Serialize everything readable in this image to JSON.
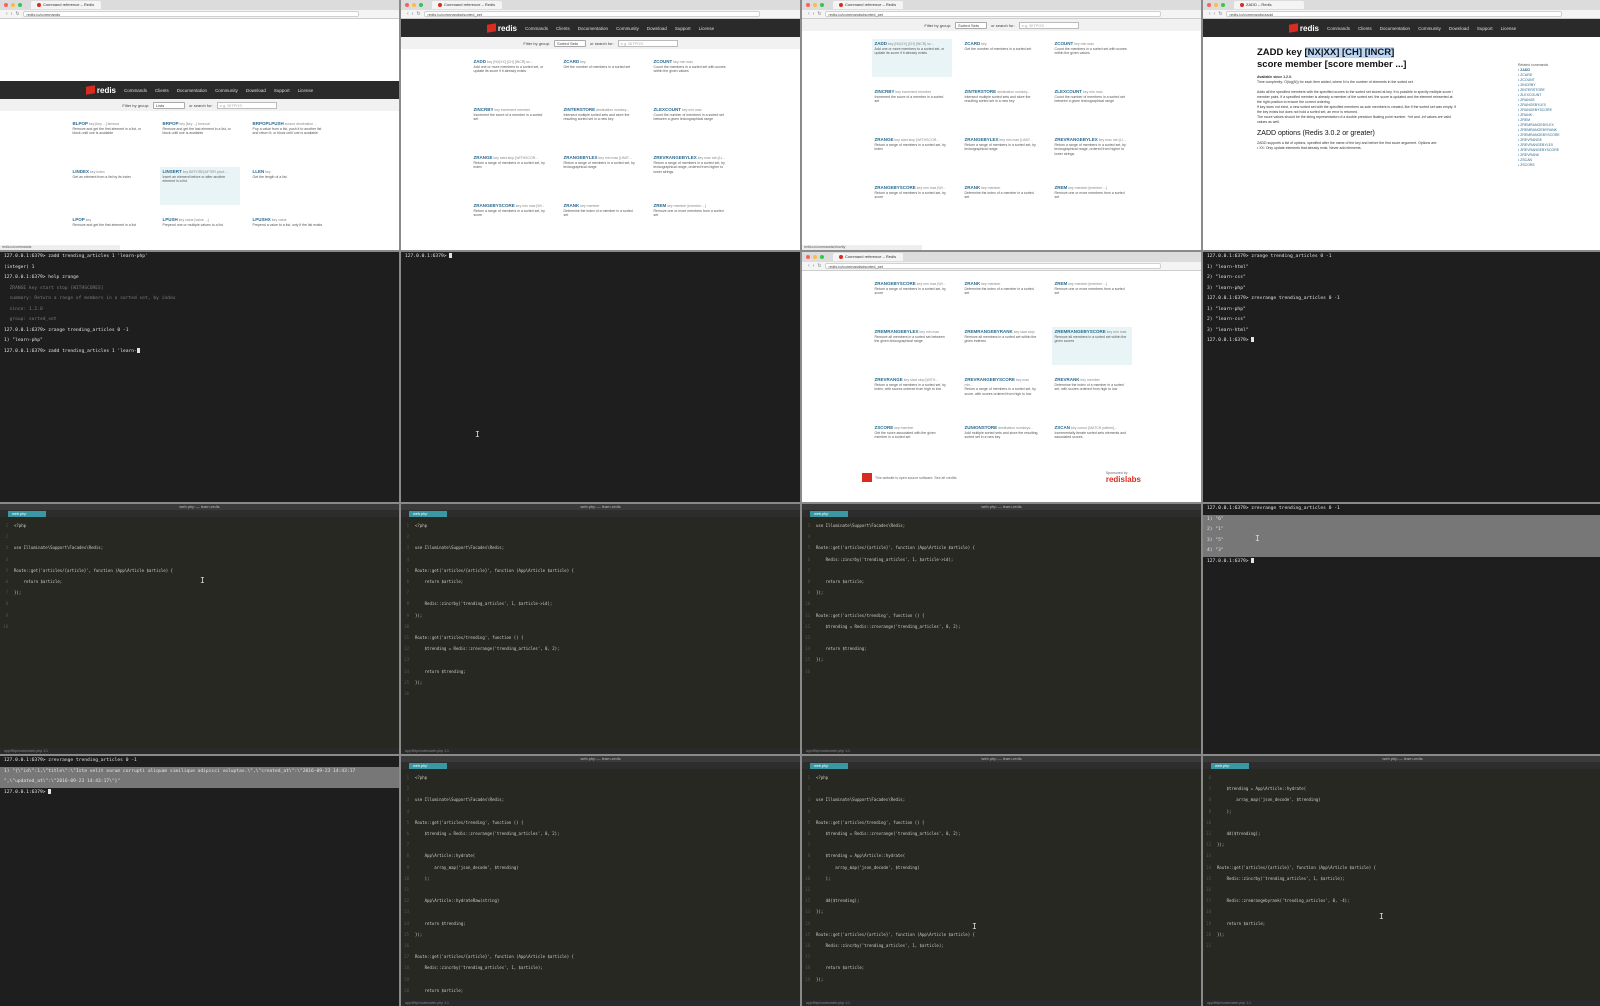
{
  "browser": {
    "tab_title": "Command reference – Redis",
    "tab_title_zadd": "ZADD – Redis",
    "url_commands": "redis.io/commands",
    "url_sorted": "redis.io/commands#sorted_set",
    "url_zadd": "redis.io/commands/zadd",
    "logo": "redis",
    "nav": [
      "Commands",
      "Clients",
      "Documentation",
      "Community",
      "Download",
      "Support",
      "License"
    ],
    "filter_label": "Filter by group:",
    "search_label": "or search for:",
    "search_placeholder": "e.g. BITPOS",
    "group_list": "Lists",
    "group_sorted": "Sorted Sets",
    "status_url": "redis.io/commands/zincrby"
  },
  "list_commands": [
    {
      "name": "BLPOP",
      "args": "key [key ...] timeout",
      "desc": "Remove and get the first element in a list, or block until one is available"
    },
    {
      "name": "BRPOP",
      "args": "key [key ...] timeout",
      "desc": "Remove and get the last element in a list, or block until one is available"
    },
    {
      "name": "BRPOPLPUSH",
      "args": "source destination ...",
      "desc": "Pop a value from a list, push it to another list and return it; or block until one is available"
    },
    {
      "name": "LINDEX",
      "args": "key index",
      "desc": "Get an element from a list by its index"
    },
    {
      "name": "LINSERT",
      "args": "key BEFORE|AFTER pivot ...",
      "desc": "Insert an element before or after another element in a list"
    },
    {
      "name": "LLEN",
      "args": "key",
      "desc": "Get the length of a list"
    },
    {
      "name": "LPOP",
      "args": "key",
      "desc": "Remove and get the first element in a list"
    },
    {
      "name": "LPUSH",
      "args": "key value [value ...]",
      "desc": "Prepend one or multiple values to a list"
    },
    {
      "name": "LPUSHX",
      "args": "key value",
      "desc": "Prepend a value to a list, only if the list exists"
    }
  ],
  "sorted_commands": [
    {
      "name": "ZADD",
      "args": "key [NX|XX] [CH] [INCR] sc...",
      "desc": "Add one or more members to a sorted set, or update its score if it already exists"
    },
    {
      "name": "ZCARD",
      "args": "key",
      "desc": "Get the number of members in a sorted set"
    },
    {
      "name": "ZCOUNT",
      "args": "key min max",
      "desc": "Count the members in a sorted set with scores within the given values"
    },
    {
      "name": "ZINCRBY",
      "args": "key increment member",
      "desc": "Increment the score of a member in a sorted set"
    },
    {
      "name": "ZINTERSTORE",
      "args": "destination numkey...",
      "desc": "Intersect multiple sorted sets and store the resulting sorted set in a new key"
    },
    {
      "name": "ZLEXCOUNT",
      "args": "key min max",
      "desc": "Count the number of members in a sorted set between a given lexicographical range"
    },
    {
      "name": "ZRANGE",
      "args": "key start stop [WITHSCOR...",
      "desc": "Return a range of members in a sorted set, by index"
    },
    {
      "name": "ZRANGEBYLEX",
      "args": "key min max [LIMIT...",
      "desc": "Return a range of members in a sorted set, by lexicographical range"
    },
    {
      "name": "ZREVRANGEBYLEX",
      "args": "key max min [LI...",
      "desc": "Return a range of members in a sorted set, by lexicographical range, ordered from higher to lower strings."
    },
    {
      "name": "ZRANGEBYSCORE",
      "args": "key min max [WI...",
      "desc": "Return a range of members in a sorted set, by score"
    },
    {
      "name": "ZRANK",
      "args": "key member",
      "desc": "Determine the index of a member in a sorted set"
    },
    {
      "name": "ZREM",
      "args": "key member [member ...]",
      "desc": "Remove one or more members from a sorted set"
    }
  ],
  "sorted_commands_2": [
    {
      "name": "ZRANGEBYSCORE",
      "args": "key min max [WI...",
      "desc": "Return a range of members in a sorted set, by score"
    },
    {
      "name": "ZRANK",
      "args": "key member",
      "desc": "Determine the index of a member in a sorted set"
    },
    {
      "name": "ZREM",
      "args": "key member [member ...]",
      "desc": "Remove one or more members from a sorted set"
    },
    {
      "name": "ZREMRANGEBYLEX",
      "args": "key min max",
      "desc": "Remove all members in a sorted set between the given lexicographical range"
    },
    {
      "name": "ZREMRANGEBYRANK",
      "args": "key start stop",
      "desc": "Remove all members in a sorted set within the given indexes"
    },
    {
      "name": "ZREMRANGEBYSCORE",
      "args": "key min max",
      "desc": "Remove all members in a sorted set within the given scores"
    },
    {
      "name": "ZREVRANGE",
      "args": "key start stop [WITH...",
      "desc": "Return a range of members in a sorted set, by index, with scores ordered from high to low"
    },
    {
      "name": "ZREVRANGEBYSCORE",
      "args": "key max min...",
      "desc": "Return a range of members in a sorted set, by score, with scores ordered from high to low"
    },
    {
      "name": "ZREVRANK",
      "args": "key member",
      "desc": "Determine the index of a member in a sorted set, with scores ordered from high to low"
    },
    {
      "name": "ZSCORE",
      "args": "key member",
      "desc": "Get the score associated with the given member in a sorted set"
    },
    {
      "name": "ZUNIONSTORE",
      "args": "destination numkeys...",
      "desc": "Add multiple sorted sets and store the resulting sorted set in a new key"
    },
    {
      "name": "ZSCAN",
      "args": "key cursor [MATCH pattern]...",
      "desc": "Incrementally iterate sorted sets elements and associated scores"
    }
  ],
  "footer": {
    "text": "This website is open source software. See all credits.",
    "sponsor": "Sponsored by",
    "brand": "redislabs"
  },
  "zadd_doc": {
    "title_pre": "ZADD key ",
    "title_hl": "[NX|XX] [CH] [INCR]",
    "title_post": "score member [score member ...]",
    "available": "Available since 1.2.0.",
    "complexity": "Time complexity: O(log(N)) for each item added, where N is the number of elements in the sorted set.",
    "p1": "Adds all the specified members with the specified scores to the sorted set stored at key. It is possible to specify multiple score / member pairs. If a specified member is already a member of the sorted set, the score is updated and the element reinserted at the right position to ensure the correct ordering.",
    "p2": "If key does not exist, a new sorted set with the specified members as sole members is created, like if the sorted set was empty. If the key exists but does not hold a sorted set, an error is returned.",
    "p3": "The score values should be the string representation of a double precision floating point number. +inf and -inf values are valid values as well.",
    "h2": "ZADD options (Redis 3.0.2 or greater)",
    "p4": "ZADD supports a list of options, specified after the name of the key and before the first score argument. Options are:",
    "li": "XX: Only update elements that already exist. Never add elements.",
    "related_title": "Related commands",
    "related": [
      "ZADD",
      "ZCARD",
      "ZCOUNT",
      "ZINCRBY",
      "ZINTERSTORE",
      "ZLEXCOUNT",
      "ZRANGE",
      "ZRANGEBYLEX",
      "ZRANGEBYSCORE",
      "ZRANK",
      "ZREM",
      "ZREMRANGEBYLEX",
      "ZREMRANGEBYRANK",
      "ZREMRANGEBYSCORE",
      "ZREVRANGE",
      "ZREVRANGEBYLEX",
      "ZREVRANGEBYSCORE",
      "ZREVRANK",
      "ZSCAN",
      "ZSCORE"
    ]
  },
  "term1": [
    "127.0.0.1:6379> zadd trending_articles 1 'learn-php'",
    "(integer) 1",
    "127.0.0.1:6379> help zrange",
    "",
    "  ZRANGE key start stop [WITHSCORES]",
    "  summary: Return a range of members in a sorted set, by index",
    "  since: 1.2.0",
    "  group: sorted_set",
    "",
    "127.0.0.1:6379> zrange trending_articles 0 -1",
    "1) \"learn-php\"",
    "127.0.0.1:6379> zadd trending_articles 1 'learn-"
  ],
  "term2": [
    "127.0.0.1:6379> "
  ],
  "term3": [
    "127.0.0.1:6379> zrange trending_articles 0 -1",
    "1) \"learn-html\"",
    "2) \"learn-css\"",
    "3) \"learn-php\"",
    "127.0.0.1:6379> zrevrange trending_articles 0 -1",
    "1) \"learn-php\"",
    "2) \"learn-css\"",
    "3) \"learn-html\"",
    "127.0.0.1:6379> "
  ],
  "term4": [
    "127.0.0.1:6379> zrevrange trending_articles 0 -1",
    "1) \"6\"",
    "2) \"1\"",
    "3) \"5\"",
    "4) \"3\"",
    "127.0.0.1:6379> "
  ],
  "term5": [
    "127.0.0.1:6379> zrevrange trending_articles 0 -1",
    "1) \"{\\\"id\\\":1,\\\"title\\\":\\\"Iste velit earum corrupti aliquam similique adipisci voluptas.\\\",\\\"created_at\\\":\\\"2016-09-23 14:43:17",
    "\",\\\"updated_at\\\":\\\"2016-09-23 14:43:17\\\"}\"",
    "127.0.0.1:6379> "
  ],
  "editor": {
    "title": "web.php — learn-redis",
    "tab": "web.php",
    "status": "app/Http/routes/web.php  1:1",
    "code1": [
      "<?php",
      "",
      "use Illuminate\\Support\\Facades\\Redis;",
      "",
      "Route::get('articles/{article}', function (App\\Article $article) {",
      "    return $article;",
      "});",
      "",
      "",
      ""
    ],
    "code2": [
      "<?php",
      "",
      "use Illuminate\\Support\\Facades\\Redis;",
      "",
      "Route::get('articles/{article}', function (App\\Article $article) {",
      "    return $article;",
      "",
      "    Redis::zincrby('trending_articles', 1, $article->id);",
      "});",
      "",
      "Route::get('articles/trending', function () {",
      "    $trending = Redis::zrevrange('trending_articles', 0, 2);",
      "",
      "    return $trending;",
      "});",
      ""
    ],
    "code3": [
      "use Illuminate\\Support\\Facades\\Redis;",
      "",
      "Route::get('articles/{article}', function (App\\Article $article) {",
      "    Redis::zincrby('trending_articles', 1, $article->id);",
      "",
      "    return $article;",
      "});",
      "",
      "Route::get('articles/trending', function () {",
      "    $trending = Redis::zrevrange('trending_articles', 0, 2);",
      "",
      "    return $trending;",
      "});",
      ""
    ],
    "code4": [
      "<?php",
      "",
      "use Illuminate\\Support\\Facades\\Redis;",
      "",
      "Route::get('articles/trending', function () {",
      "    $trending = Redis::zrevrange('trending_articles', 0, 2);",
      "",
      "    App\\Article::hydrate(",
      "        array_map('json_decode', $trending)",
      "    );",
      "",
      "    App\\Article::hydrateRaw(string)",
      "",
      "    return $trending;",
      "});",
      "",
      "Route::get('articles/{article}', function (App\\Article $article) {",
      "    Redis::zincrby('trending_articles', 1, $article);",
      "",
      "    return $article;"
    ],
    "code5": [
      "<?php",
      "",
      "use Illuminate\\Support\\Facades\\Redis;",
      "",
      "Route::get('articles/trending', function () {",
      "    $trending = Redis::zrevrange('trending_articles', 0, 2);",
      "",
      "    $trending = App\\Article::hydrate(",
      "        array_map('json_decode', $trending)",
      "    );",
      "",
      "    dd($trending);",
      "});",
      "",
      "Route::get('articles/{article}', function (App\\Article $article) {",
      "    Redis::zincrby('trending_articles', 1, $article);",
      "",
      "    return $article;",
      "});"
    ],
    "code6": [
      "",
      "    $trending = App\\Article::hydrate(",
      "        array_map('json_decode', $trending)",
      "    );",
      "",
      "    dd($trending);",
      "});",
      "",
      "Route::get('articles/{article}', function (App\\Article $article) {",
      "    Redis::zincrby('trending_articles', 1, $article);",
      "",
      "    Redis::zremrangebyrank('trending_articles', 0, -4);",
      "",
      "    return $article;",
      "});",
      ""
    ]
  }
}
